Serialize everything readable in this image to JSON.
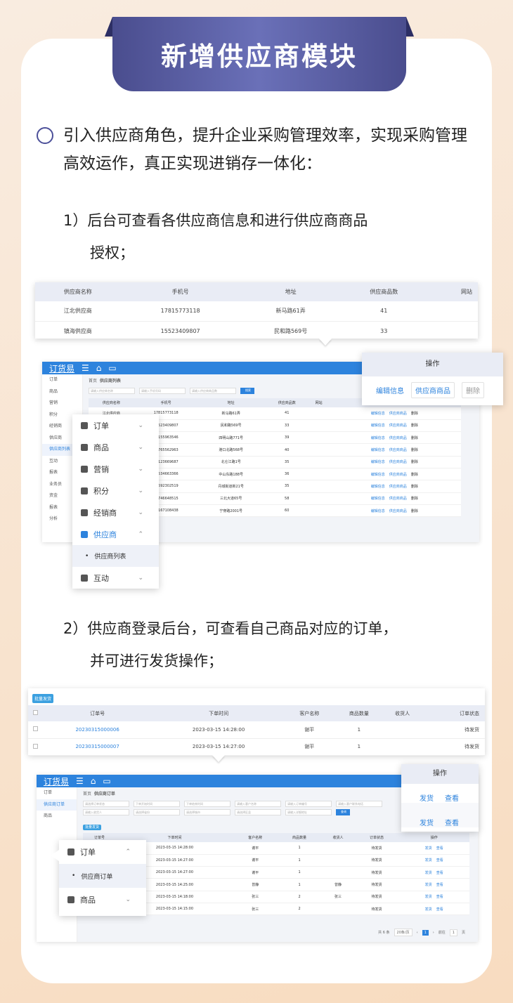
{
  "banner": {
    "title": "新增供应商模块"
  },
  "intro": {
    "text": "引入供应商角色，提升企业采购管理效率，实现采购管理高效运作，真正实现进销存一体化："
  },
  "step1": {
    "line1": "1）后台可查看各供应商信息和进行供应商商品",
    "line2": "授权；"
  },
  "step2": {
    "line1": "2）供应商登录后台，可查看自己商品对应的订单，",
    "line2": "并可进行发货操作；"
  },
  "sup_table": {
    "headers": [
      "供应商名称",
      "手机号",
      "地址",
      "供应商品数",
      "网站"
    ],
    "rows": [
      [
        "江北供应商",
        "17815773118",
        "新马路61弄",
        "41",
        ""
      ],
      [
        "镇海供应商",
        "15523409807",
        "民和路569号",
        "33",
        ""
      ]
    ]
  },
  "app1": {
    "logo": "订货易",
    "breadcrumb_home": "首页",
    "breadcrumb_page": "供应商列表",
    "search_placeholders": [
      "请输入供应商名称",
      "请输入手机号码",
      "请输入供应商商品数"
    ],
    "search_btn": "搜索",
    "side": [
      "订单",
      "商品",
      "营销",
      "积分",
      "经销商",
      "供应商",
      "供应商列表",
      "互动",
      "报表",
      "业务员",
      "资金",
      "报表",
      "分析"
    ],
    "headers": [
      "供应商名称",
      "手机号",
      "地址",
      "供应商品数",
      "网站",
      "操作"
    ],
    "rows": [
      [
        "江北供应商",
        "17815773118",
        "新马路61弄",
        "41"
      ],
      [
        "镇海供应商",
        "15523409807",
        "民和路569号",
        "33"
      ],
      [
        "",
        "18155963546",
        "四明山路771号",
        "39"
      ],
      [
        "",
        "13765562963",
        "港口北路568号",
        "40"
      ],
      [
        "",
        "15123669687",
        "北仑江路1号",
        "35"
      ],
      [
        "",
        "15534663366",
        "中山东路188号",
        "36"
      ],
      [
        "",
        "13592302519",
        "丹城街道新21号",
        "35"
      ],
      [
        "",
        "15746648515",
        "三北大道65号",
        "58"
      ],
      [
        "",
        "15167108438",
        "宁穿路2001号",
        "60"
      ]
    ],
    "row_ops": [
      "编辑信息",
      "供应商商品",
      "删除"
    ]
  },
  "menu1": {
    "items": [
      "订单",
      "商品",
      "营销",
      "积分",
      "经销商",
      "供应商"
    ],
    "sub": "供应商列表",
    "last": "互动"
  },
  "ops1": {
    "header": "操作",
    "edit": "编辑信息",
    "goods": "供应商商品",
    "delete": "删除"
  },
  "order_table": {
    "batch": "批量发货",
    "headers": [
      "订单号",
      "下单时间",
      "客户名称",
      "商品数量",
      "收货人",
      "订单状态"
    ],
    "rows": [
      [
        "20230315000006",
        "2023-03-15 14:28:00",
        "谢平",
        "1",
        "",
        "待发货"
      ],
      [
        "20230315000007",
        "2023-03-15 14:27:00",
        "谢平",
        "1",
        "",
        "待发货"
      ]
    ]
  },
  "app2": {
    "logo": "订货易",
    "breadcrumb_home": "首页",
    "breadcrumb_page": "供应商订单",
    "side": [
      "订单",
      "供应商订单",
      "商品"
    ],
    "filters": [
      "请选择订单状态",
      "下单开始时间",
      "下单结束时间",
      "请输入客户名称",
      "请输入订单编号",
      "请输入客户联系电话",
      "请输入收货人",
      "请选择省份",
      "请选择城市",
      "请选择区县",
      "请输入详细地址"
    ],
    "search_btn": "查询",
    "batch": "批量发货",
    "headers": [
      "",
      "订单号",
      "下单时间",
      "客户名称",
      "商品数量",
      "收货人",
      "订单状态",
      "操作"
    ],
    "rows": [
      [
        "",
        "2023-03-15 14:28:00",
        "谢平",
        "1",
        "",
        "待发货"
      ],
      [
        "",
        "2023-03-15 14:27:00",
        "谢平",
        "1",
        "",
        "待发货"
      ],
      [
        "",
        "2023-03-15 14:27:00",
        "谢平",
        "1",
        "",
        "待发货"
      ],
      [
        "",
        "2023-03-15 14:25:00",
        "曾静",
        "1",
        "曾静",
        "待发货"
      ],
      [
        "",
        "2023-03-15 14:18:00",
        "张三",
        "2",
        "张三",
        "待发货"
      ],
      [
        "",
        "2023-03-15 14:15:00",
        "张三",
        "2",
        "",
        "待发货"
      ]
    ],
    "row_ops": [
      "发货",
      "查看"
    ],
    "pager": {
      "total": "共 6 条",
      "size": "20条/页",
      "page": "1",
      "goto": "前往",
      "goto_page": "1",
      "unit": "页"
    }
  },
  "menu2": {
    "item1": "订单",
    "sub": "供应商订单",
    "item2": "商品"
  },
  "ops2": {
    "header": "操作",
    "ship": "发货",
    "view": "查看"
  }
}
